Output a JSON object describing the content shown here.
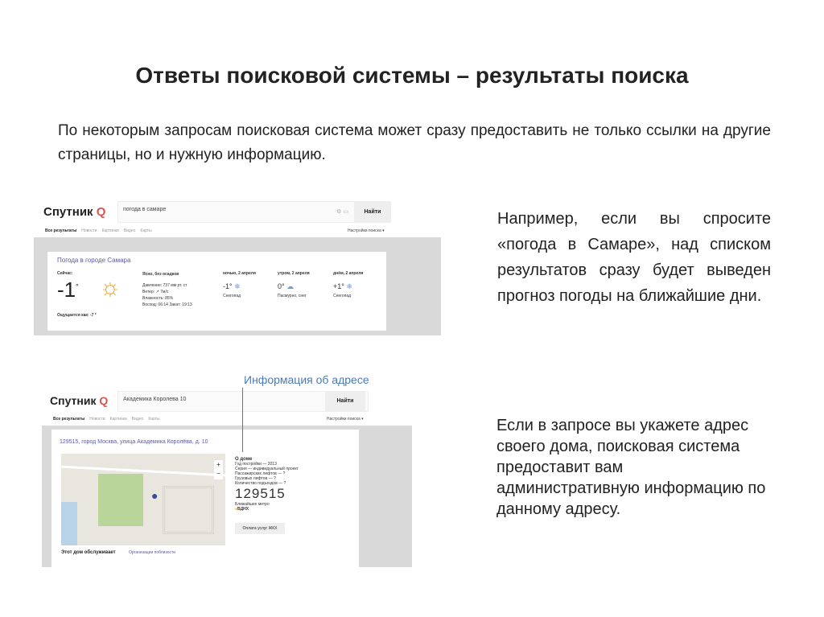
{
  "title": "Ответы поисковой системы – результаты поиска",
  "intro": "По некоторым запросам поисковая система может сразу предоставить не только ссылки на другие страницы, но и нужную информацию.",
  "side1": "Например, если вы спросите «погода в Самаре», над списком результатов сразу будет выведен прогноз погоды на ближайшие дни.",
  "side2": "Если в запросе вы укажете адрес своего дома, поисковая система предоставит вам административную информацию по данному адресу.",
  "shot1": {
    "logo": "Спутник",
    "query": "погода в самаре",
    "find": "Найти",
    "tabs": [
      "Все результаты",
      "Новости",
      "Картинки",
      "Видео",
      "Карты"
    ],
    "settings": "Настройки поиска ▾",
    "card_title": "Погода в городе Самара",
    "now_label": "Сейчас:",
    "now_temp": "-1",
    "deg": "°",
    "feels": "Ощущается как: -7 °",
    "condition": "Ясно, без осадков",
    "details": [
      "Давление: 737 мм рт. ст",
      "Ветер: ↗ 7м/с",
      "Влажность: 85%",
      "Восход: 06:14 Закат: 19:13"
    ],
    "forecast": [
      {
        "label": "ночью, 2 апреля",
        "temp": "-1°",
        "desc": "Снегопад"
      },
      {
        "label": "утром, 2 апреля",
        "temp": "0°",
        "desc": "Пасмурно, снег"
      },
      {
        "label": "днём, 2 апреля",
        "temp": "+1°",
        "desc": "Снегопад"
      }
    ]
  },
  "shot2": {
    "callout": "Информация об адресе",
    "logo": "Спутник",
    "query": "Академика Королева 10",
    "find": "Найти",
    "tabs": [
      "Все результаты",
      "Новости",
      "Картинки",
      "Видео",
      "Карты"
    ],
    "settings": "Настройки поиска ▾",
    "address": "129515, город Москва, улица Академика Королёва, д. 10",
    "about_title": "О доме",
    "about": [
      "Год постройки — 2013",
      "Серия — индивидуальный проект",
      "Пассажирских лифтов — ?",
      "Грузовых лифтов — ?",
      "Количество подъездов — ?"
    ],
    "postcode": "129515",
    "metro_label": "Ближайшее метро",
    "metro": "ВДНХ",
    "pay_button": "Оплата услуг ЖКХ",
    "served_label": "Этот дом обслуживает",
    "served_link": "Организации поблизости",
    "zoom_in": "+",
    "zoom_out": "−"
  }
}
